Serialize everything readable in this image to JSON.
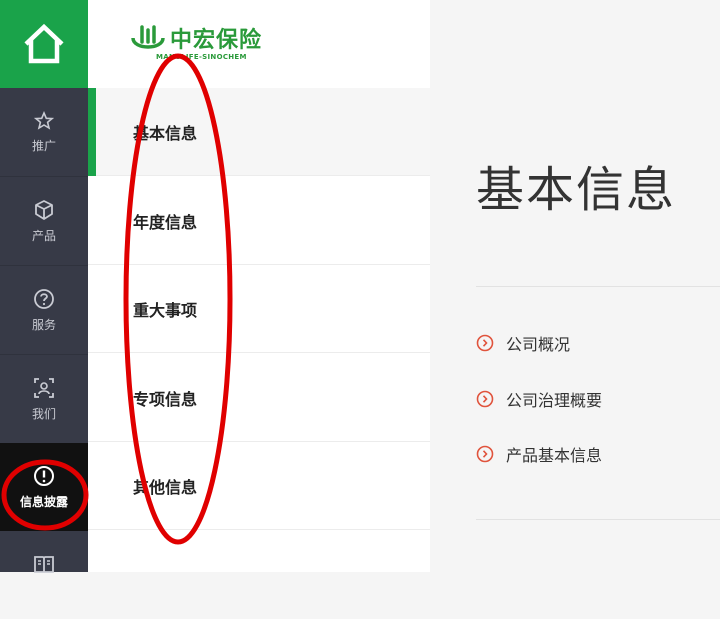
{
  "rail": {
    "home_icon": "home-icon",
    "items": [
      {
        "label": "推广",
        "icon": "star-icon"
      },
      {
        "label": "产品",
        "icon": "cube-icon"
      },
      {
        "label": "服务",
        "icon": "question-icon"
      },
      {
        "label": "我们",
        "icon": "person-scan-icon"
      },
      {
        "label": "信息披露",
        "icon": "exclamation-icon",
        "active": true
      },
      {
        "label": "",
        "icon": "book-icon"
      }
    ]
  },
  "brand": {
    "name_cn": "中宏保险",
    "name_en": "MANULIFE-SINOCHEM",
    "color": "#2a9a3a"
  },
  "subnav": {
    "items": [
      {
        "label": "基本信息",
        "active": true
      },
      {
        "label": "年度信息"
      },
      {
        "label": "重大事项"
      },
      {
        "label": "专项信息"
      },
      {
        "label": "其他信息"
      }
    ]
  },
  "content": {
    "title": "基本信息",
    "links": [
      {
        "label": "公司概况"
      },
      {
        "label": "公司治理概要"
      },
      {
        "label": "产品基本信息"
      }
    ]
  },
  "colors": {
    "accent": "#1aa34a",
    "rail_bg": "#373a47",
    "link_icon": "#e0533c",
    "annotation": "#e00000"
  }
}
